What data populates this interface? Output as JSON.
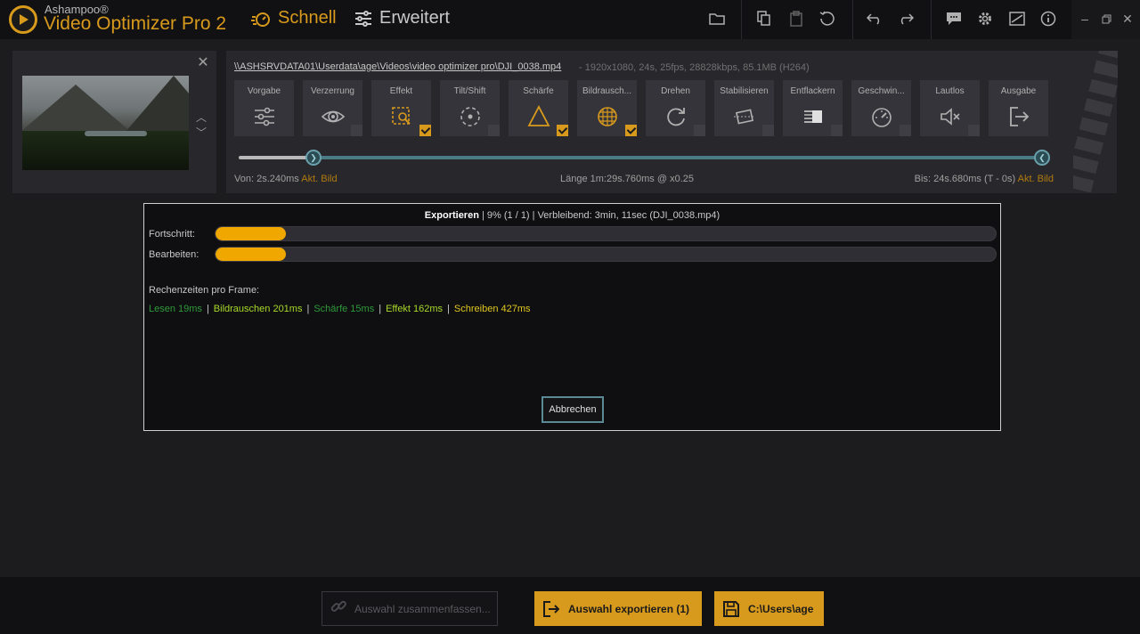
{
  "app": {
    "brand": "Ashampoo®",
    "title": "Video Optimizer Pro 2"
  },
  "modes": {
    "quick": "Schnell",
    "advanced": "Erweitert"
  },
  "file": {
    "path": "\\\\ASHSRVDATA01\\Userdata\\age\\Videos\\video optimizer pro\\DJI_0038.mp4",
    "meta": "-   1920x1080, 24s, 25fps, 28828kbps, 85.1MB (H264)"
  },
  "tools": [
    {
      "label": "Vorgabe",
      "icon": "sliders-icon",
      "checked": false,
      "hasCheck": false
    },
    {
      "label": "Verzerrung",
      "icon": "eye-icon",
      "checked": false,
      "hasCheck": true
    },
    {
      "label": "Effekt",
      "icon": "effect-icon",
      "checked": true,
      "hasCheck": true
    },
    {
      "label": "Tilt/Shift",
      "icon": "tiltshift-icon",
      "checked": false,
      "hasCheck": true
    },
    {
      "label": "Schärfe",
      "icon": "sharpness-icon",
      "checked": true,
      "hasCheck": true
    },
    {
      "label": "Bildrausch...",
      "icon": "noise-icon",
      "checked": true,
      "hasCheck": true
    },
    {
      "label": "Drehen",
      "icon": "rotate-icon",
      "checked": false,
      "hasCheck": true
    },
    {
      "label": "Stabilisieren",
      "icon": "stabilize-icon",
      "checked": false,
      "hasCheck": true
    },
    {
      "label": "Entflackern",
      "icon": "deflicker-icon",
      "checked": false,
      "hasCheck": true
    },
    {
      "label": "Geschwin...",
      "icon": "speed-icon",
      "checked": false,
      "hasCheck": true
    },
    {
      "label": "Lautlos",
      "icon": "mute-icon",
      "checked": false,
      "hasCheck": true
    },
    {
      "label": "Ausgabe",
      "icon": "output-icon",
      "checked": false,
      "hasCheck": false
    }
  ],
  "range": {
    "von_label": "Von:",
    "von_value": "2s.240ms",
    "akt": "Akt. Bild",
    "laenge_label": "Länge",
    "laenge_value": "1m:29s.760ms @ x0.25",
    "bis_label": "Bis:",
    "bis_value": "24s.680ms (T - 0s)"
  },
  "dialog": {
    "title_bold": "Exportieren",
    "title_rest": "|  9% (1 / 1)  |  Verbleibend:   3min, 11sec (DJI_0038.mp4)",
    "progress_label": "Fortschritt:",
    "progress_value": 0.09,
    "edit_label": "Bearbeiten:",
    "edit_value": 0.09,
    "timing_header": "Rechenzeiten pro Frame:",
    "timings": [
      {
        "text": "Lesen 19ms",
        "color": "#2e9a3a"
      },
      {
        "text": "Bildrauschen 201ms",
        "color": "#a8d82a"
      },
      {
        "text": "Schärfe 15ms",
        "color": "#2e9a3a"
      },
      {
        "text": "Effekt 162ms",
        "color": "#a8d82a"
      },
      {
        "text": "Schreiben 427ms",
        "color": "#e0c820"
      }
    ],
    "cancel": "Abbrechen"
  },
  "bottom": {
    "merge": "Auswahl zusammenfassen...",
    "export": "Auswahl exportieren (1)",
    "path": "C:\\Users\\age"
  },
  "colors": {
    "accent": "#d89a1c",
    "progress": "#f0a800",
    "slider": "#4a7a84"
  }
}
